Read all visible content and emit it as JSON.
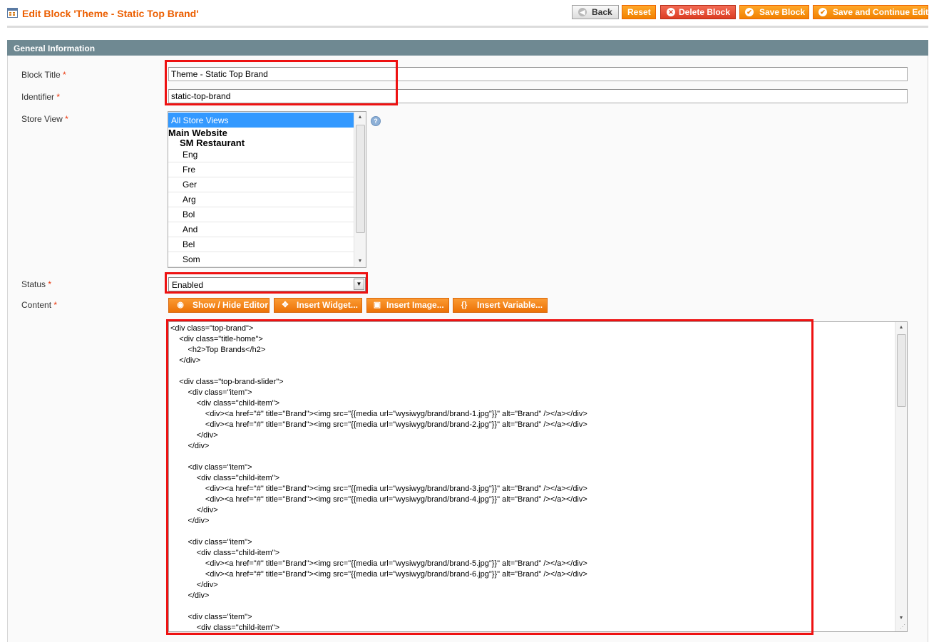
{
  "page": {
    "title": "Edit Block 'Theme - Static Top Brand'"
  },
  "toolbar": {
    "back_label": "Back",
    "reset_label": "Reset",
    "delete_label": "Delete Block",
    "save_label": "Save Block",
    "save_continue_label": "Save and Continue Edit"
  },
  "section": {
    "title": "General Information"
  },
  "form": {
    "block_title": {
      "label": "Block Title",
      "required": "*",
      "value": "Theme - Static Top Brand"
    },
    "identifier": {
      "label": "Identifier",
      "required": "*",
      "value": "static-top-brand"
    },
    "store_view": {
      "label": "Store View",
      "required": "*",
      "selected": "All Store Views",
      "website": "Main Website",
      "store": "SM Restaurant",
      "views": [
        "Eng",
        "Fre",
        "Ger",
        "Arg",
        "Bol",
        "And",
        "Bel",
        "Som"
      ]
    },
    "status": {
      "label": "Status",
      "required": "*",
      "value": "Enabled"
    },
    "content": {
      "label": "Content",
      "required": "*",
      "show_hide_label": "Show / Hide Editor",
      "insert_widget_label": "Insert Widget...",
      "insert_image_label": "Insert Image...",
      "insert_variable_label": "Insert Variable...",
      "code": "<div class=\"top-brand\">\n\t<div class=\"title-home\">\n\t\t<h2>Top Brands</h2>\n\t</div>\n\n\t<div class=\"top-brand-slider\">\n\t\t<div class=\"item\">\n\t\t\t<div class=\"child-item\">\n\t\t\t\t<div><a href=\"#\" title=\"Brand\"><img src=\"{{media url=\"wysiwyg/brand/brand-1.jpg\"}}\" alt=\"Brand\" /></a></div>\n\t\t\t\t<div><a href=\"#\" title=\"Brand\"><img src=\"{{media url=\"wysiwyg/brand/brand-2.jpg\"}}\" alt=\"Brand\" /></a></div>\n\t\t\t</div>\n\t\t</div>\n\n\t\t<div class=\"item\">\n\t\t\t<div class=\"child-item\">\n\t\t\t\t<div><a href=\"#\" title=\"Brand\"><img src=\"{{media url=\"wysiwyg/brand/brand-3.jpg\"}}\" alt=\"Brand\" /></a></div>\n\t\t\t\t<div><a href=\"#\" title=\"Brand\"><img src=\"{{media url=\"wysiwyg/brand/brand-4.jpg\"}}\" alt=\"Brand\" /></a></div>\n\t\t\t</div>\n\t\t</div>\n\n\t\t<div class=\"item\">\n\t\t\t<div class=\"child-item\">\n\t\t\t\t<div><a href=\"#\" title=\"Brand\"><img src=\"{{media url=\"wysiwyg/brand/brand-5.jpg\"}}\" alt=\"Brand\" /></a></div>\n\t\t\t\t<div><a href=\"#\" title=\"Brand\"><img src=\"{{media url=\"wysiwyg/brand/brand-6.jpg\"}}\" alt=\"Brand\" /></a></div>\n\t\t\t</div>\n\t\t</div>\n\n\t\t<div class=\"item\">\n\t\t\t<div class=\"child-item\">"
    }
  },
  "icons": {
    "page": "grid-page-icon",
    "back": "arrow-left-icon",
    "delete": "cancel-circle-icon",
    "save": "check-circle-icon",
    "help": "question-icon",
    "show_hide": "eye-icon",
    "widget": "widget-icon",
    "image": "image-icon",
    "variable": "variable-icon"
  },
  "colors": {
    "accent": "#eb5e00",
    "button": "#f18100",
    "delete_button": "#dc3c22",
    "section_header": "#6f8992",
    "selected_option": "#3399ff",
    "highlight": "#ee1111"
  }
}
